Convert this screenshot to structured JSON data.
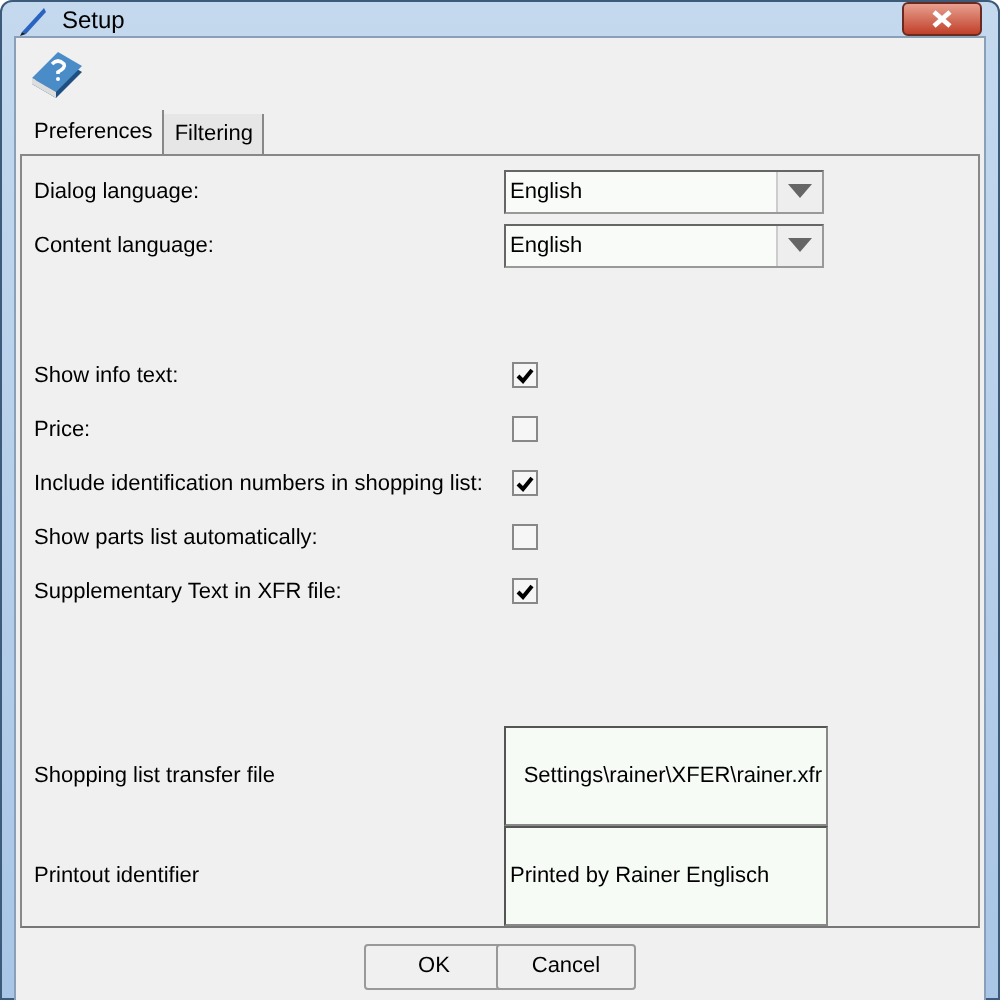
{
  "window": {
    "title": "Setup"
  },
  "tabs": [
    {
      "label": "Preferences",
      "selected": true
    },
    {
      "label": "Filtering",
      "selected": false
    }
  ],
  "dropdowns": [
    {
      "label": "Dialog language:",
      "value": "English"
    },
    {
      "label": "Content language:",
      "value": "English"
    }
  ],
  "checkboxes": [
    {
      "label": "Show info text:",
      "checked": true
    },
    {
      "label": "Price:",
      "checked": false
    },
    {
      "label": "Include identification numbers in shopping list:",
      "checked": true
    },
    {
      "label": "Show parts list automatically:",
      "checked": false
    },
    {
      "label": "Supplementary Text in XFR file:",
      "checked": true
    }
  ],
  "text_fields": [
    {
      "label": "Shopping list transfer file",
      "value": "Settings\\rainer\\XFER\\rainer.xfr"
    },
    {
      "label": "Printout identifier",
      "value": "Printed by Rainer Englisch"
    }
  ],
  "buttons": [
    "OK",
    "Cancel"
  ]
}
